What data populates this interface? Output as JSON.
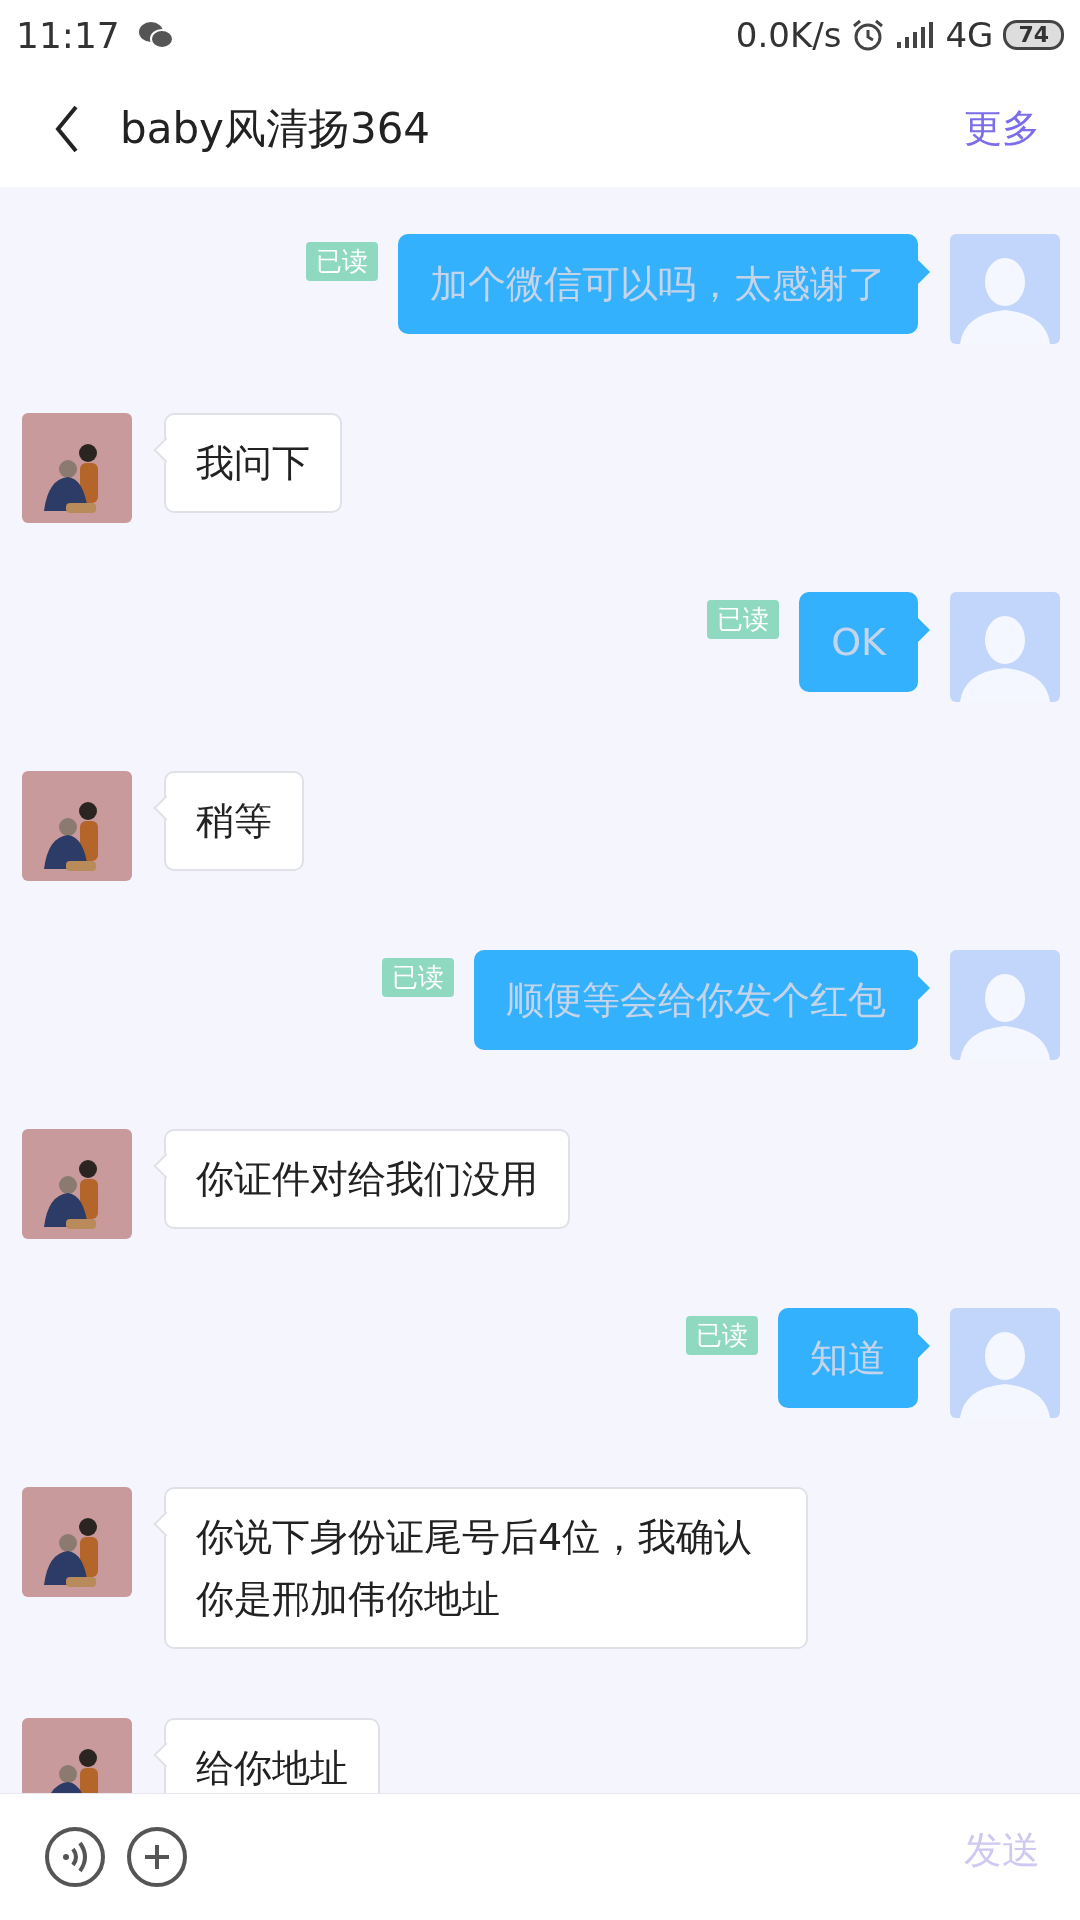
{
  "status_bar": {
    "time": "11:17",
    "speed": "0.0K/s",
    "network": "4G",
    "battery": "74"
  },
  "header": {
    "title": "baby风清扬364",
    "more": "更多"
  },
  "messages": [
    {
      "kind": "sent",
      "text": "加个微信可以吗，太感谢了",
      "read_tag": "已读"
    },
    {
      "kind": "received",
      "text": "我问下"
    },
    {
      "kind": "sent",
      "text": "OK",
      "read_tag": "已读"
    },
    {
      "kind": "received",
      "text": "稍等"
    },
    {
      "kind": "sent",
      "text": "顺便等会给你发个红包",
      "read_tag": "已读"
    },
    {
      "kind": "received",
      "text": "你证件对给我们没用"
    },
    {
      "kind": "sent",
      "text": "知道",
      "read_tag": "已读"
    },
    {
      "kind": "received",
      "text": "你说下身份证尾号后4位，我确认你是邢加伟你地址"
    },
    {
      "kind": "received",
      "text": "给你地址"
    }
  ],
  "input_bar": {
    "send": "发送",
    "send_disabled": true
  }
}
